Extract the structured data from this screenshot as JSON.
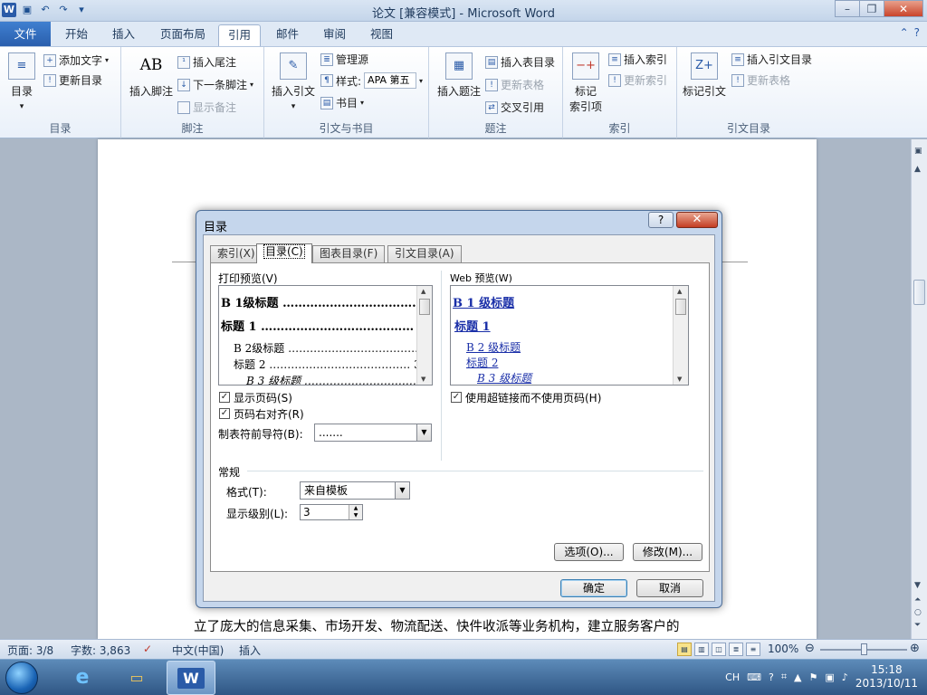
{
  "app": {
    "title": "论文 [兼容模式] - Microsoft Word",
    "logo_letter": "W",
    "qat": [
      "save-icon",
      "undo-icon",
      "redo-icon",
      "customize-icon"
    ]
  },
  "tabs": [
    "文件",
    "开始",
    "插入",
    "页面布局",
    "引用",
    "邮件",
    "审阅",
    "视图"
  ],
  "active_tab": "引用",
  "ribbon": {
    "toc_group": {
      "label": "目录",
      "toc": "目录",
      "add_text": "添加文字",
      "update": "更新目录"
    },
    "footnote_group": {
      "label": "脚注",
      "insert_footnote": "插入脚注",
      "insert_endnote": "插入尾注",
      "next_footnote": "下一条脚注",
      "show_notes": "显示备注",
      "big_icon": "AB"
    },
    "citation_group": {
      "label": "引文与书目",
      "insert_citation": "插入引文",
      "manage_sources": "管理源",
      "style_label": "样式:",
      "style_value": "APA 第五",
      "bibliography": "书目"
    },
    "caption_group": {
      "label": "题注",
      "insert_caption": "插入题注",
      "insert_figure_table": "插入表目录",
      "update_table": "更新表格",
      "cross_ref": "交叉引用"
    },
    "index_group": {
      "label": "索引",
      "mark_entry": "标记",
      "mark_entry2": "索引项",
      "insert_index": "插入索引",
      "update_index": "更新索引"
    },
    "toa_group": {
      "label": "引文目录",
      "mark_citation": "标记引文",
      "insert_toa": "插入引文目录",
      "update_table": "更新表格"
    }
  },
  "document": {
    "line": "立了庞大的信息采集、市场开发、物流配送、快件收派等业务机构，建立服务客户的"
  },
  "dialog": {
    "title": "目录",
    "help": "?",
    "close": "✕",
    "tabs": [
      "索引(X)",
      "目录(C)",
      "图表目录(F)",
      "引文目录(A)"
    ],
    "selected_tab": "目录(C)",
    "print_preview_label": "打印预览(V)",
    "print_preview": [
      {
        "text": "B 1级标题 ……………………………… 1",
        "level": 1
      },
      {
        "text": "标题 1 ………………………………… 1",
        "level": 1
      },
      {
        "text": "B 2级标题 ……………………………… 3",
        "level": 2
      },
      {
        "text": "标题 2 ………………………………… 3",
        "level": 2
      },
      {
        "text": "B 3 级标题 …………………………… 5",
        "level": 3
      }
    ],
    "web_preview_label": "Web 预览(W)",
    "web_preview": [
      {
        "text": "B 1 级标题",
        "level": 1
      },
      {
        "text": "标题 1",
        "level": 1
      },
      {
        "text": "B 2 级标题",
        "level": 2
      },
      {
        "text": "标题 2",
        "level": 2
      },
      {
        "text": "B 3 级标题",
        "level": 3
      }
    ],
    "show_page_numbers": {
      "label": "显示页码(S)",
      "checked": true
    },
    "right_align": {
      "label": "页码右对齐(R)",
      "checked": true
    },
    "tab_leader_label": "制表符前导符(B):",
    "tab_leader_value": ".......",
    "hyperlinks": {
      "label": "使用超链接而不使用页码(H)",
      "checked": true
    },
    "general_label": "常规",
    "formats_label": "格式(T):",
    "formats_value": "来自模板",
    "levels_label": "显示级别(L):",
    "levels_value": "3",
    "options_btn": "选项(O)...",
    "modify_btn": "修改(M)...",
    "ok_btn": "确定",
    "cancel_btn": "取消"
  },
  "statusbar": {
    "page": "页面: 3/8",
    "words": "字数: 3,863",
    "language": "中文(中国)",
    "mode": "插入",
    "zoom": "100%",
    "zoom_fraction": 0.5
  },
  "taskbar": {
    "tray_lang": "CH",
    "time": "15:18",
    "date": "2013/10/11"
  }
}
